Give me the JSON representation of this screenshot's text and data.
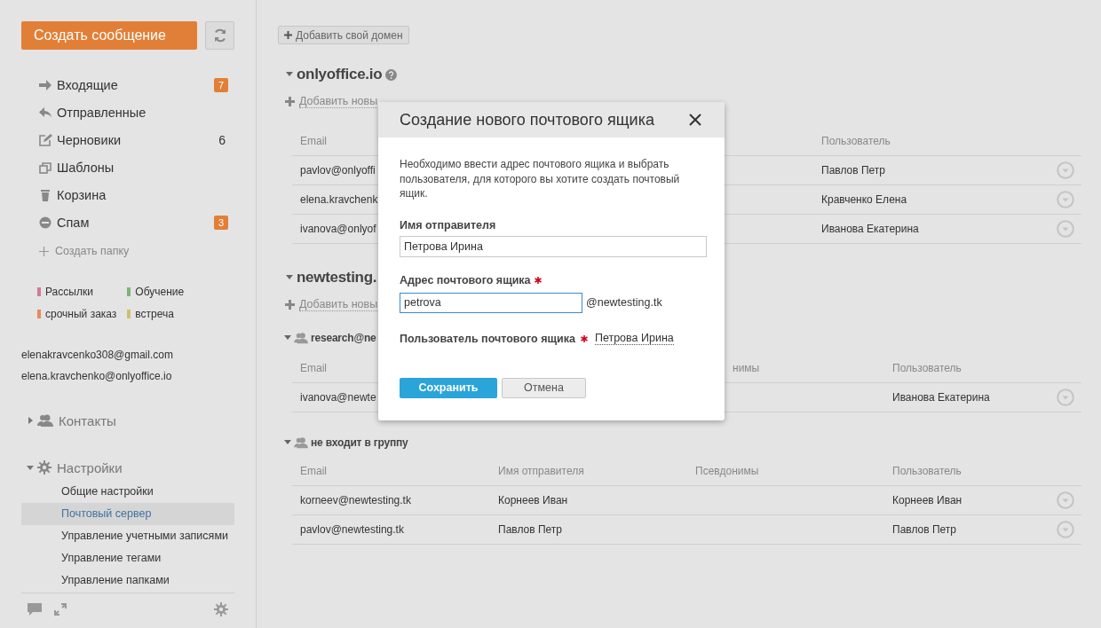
{
  "sidebar": {
    "compose_button": "Создать сообщение",
    "folders": [
      {
        "label": "Входящие",
        "count": "7",
        "badge": true
      },
      {
        "label": "Отправленные"
      },
      {
        "label": "Черновики",
        "count": "6",
        "badge": false
      },
      {
        "label": "Шаблоны"
      },
      {
        "label": "Корзина"
      },
      {
        "label": "Спам",
        "count": "3",
        "badge": true
      }
    ],
    "create_folder": "Создать папку",
    "tags": [
      {
        "label": "Рассылки",
        "color": "#d27a92"
      },
      {
        "label": "Обучение",
        "color": "#79b774"
      },
      {
        "label": "срочный заказ",
        "color": "#e58a5e"
      },
      {
        "label": "встреча",
        "color": "#cdc16c"
      }
    ],
    "accounts": [
      "elenakravcenko308@gmail.com",
      "elena.kravchenko@onlyoffice.io"
    ],
    "sections": [
      {
        "label": "Контакты",
        "expanded": false
      },
      {
        "label": "Настройки",
        "expanded": true,
        "items": [
          {
            "label": "Общие настройки",
            "selected": false
          },
          {
            "label": "Почтовый сервер",
            "selected": true
          },
          {
            "label": "Управление учетными записями",
            "selected": false
          },
          {
            "label": "Управление тегами",
            "selected": false
          },
          {
            "label": "Управление папками",
            "selected": false
          }
        ]
      }
    ]
  },
  "main": {
    "add_domain_button": "Добавить свой домен",
    "domains": [
      {
        "name": "onlyoffice.io",
        "expanded": true,
        "add_link": "Добавить новы",
        "groups": [
          {
            "columns": [
              {
                "kind": "email",
                "label": "Email"
              },
              {
                "kind": "user",
                "label": "Пользователь"
              }
            ],
            "rows": [
              {
                "email": "pavlov@onlyoffi",
                "user": "Павлов Петр"
              },
              {
                "email": "elena.kravchenk",
                "user": "Кравченко Елена"
              },
              {
                "email": "ivanova@onlyof",
                "user": "Иванова Екатерина"
              }
            ]
          }
        ]
      },
      {
        "name": "newtesting.",
        "expanded": true,
        "add_link": "Добавить новы",
        "groups": [
          {
            "name": "research@ne",
            "expanded": true,
            "columns": [
              {
                "kind": "email",
                "label": "Email"
              },
              {
                "kind": "aliases",
                "label": "нимы"
              },
              {
                "kind": "user",
                "label": "Пользователь"
              }
            ],
            "rows": [
              {
                "email": "ivanova@newte",
                "user": "Иванова Екатерина"
              }
            ]
          },
          {
            "name": "не входит в группу",
            "expanded": true,
            "columns": [
              {
                "kind": "email",
                "label": "Email"
              },
              {
                "kind": "sender",
                "label": "Имя отправителя"
              },
              {
                "kind": "aliases",
                "label": "Псевдонимы"
              },
              {
                "kind": "user",
                "label": "Пользователь"
              }
            ],
            "rows": [
              {
                "email": "korneev@newtesting.tk",
                "sender": "Корнеев Иван",
                "user": "Корнеев Иван"
              },
              {
                "email": "pavlov@newtesting.tk",
                "sender": "Павлов Петр",
                "user": "Павлов Петр"
              }
            ]
          }
        ]
      }
    ]
  },
  "dialog": {
    "title": "Создание нового почтового ящика",
    "description": "Необходимо ввести адрес почтового ящика и выбрать пользователя, для которого вы хотите создать почтовый ящик.",
    "sender_name": {
      "label": "Имя отправителя",
      "required": false,
      "value": "Петрова Ирина"
    },
    "mailbox_address": {
      "label": "Адрес почтового ящика",
      "required": true,
      "value": "petrova",
      "domain_suffix": "@newtesting.tk"
    },
    "mailbox_user": {
      "label": "Пользователь почтового ящика",
      "required": true,
      "value": "Петрова Ирина"
    },
    "save_button": "Сохранить",
    "cancel_button": "Отмена"
  }
}
